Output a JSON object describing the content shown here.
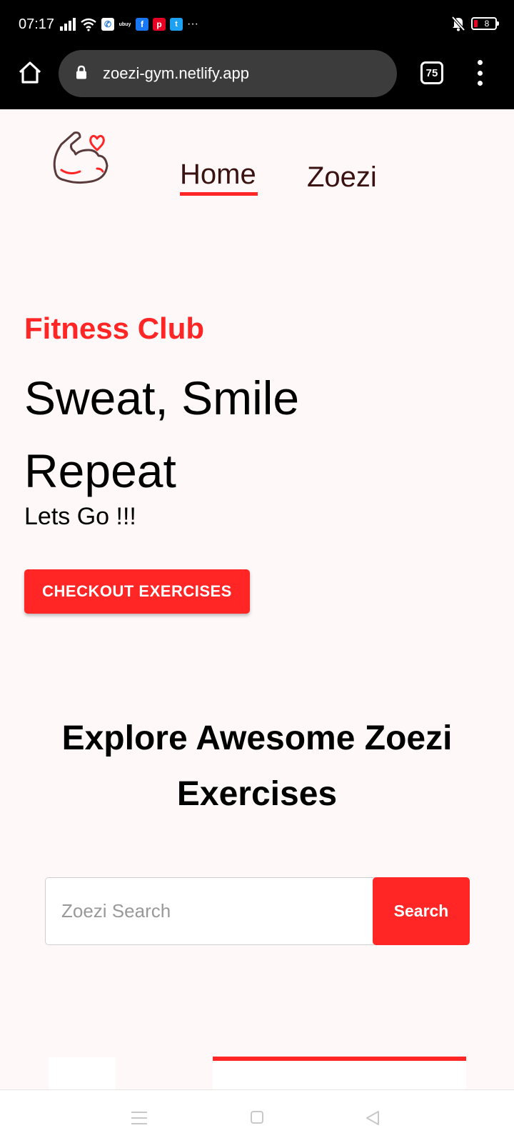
{
  "status_bar": {
    "time": "07:17",
    "battery": "8",
    "colors": {
      "background": "#000000",
      "battery_low": "#ee0022"
    },
    "icons": [
      "signal-icon",
      "wifi-icon",
      "phone-app-icon",
      "ubuy-app-icon",
      "facebook-app-icon",
      "pinterest-app-icon",
      "twitter-app-icon",
      "more-notifications-icon",
      "mute-icon",
      "battery-icon"
    ]
  },
  "browser": {
    "url": "zoezi-gym.netlify.app",
    "tab_count": "75",
    "icons": [
      "home-icon",
      "lock-icon",
      "tabs-icon",
      "overflow-menu-icon"
    ]
  },
  "nav": {
    "home": "Home",
    "zoezi": "Zoezi",
    "logo_icon": "flexed-arm-heart-icon"
  },
  "hero": {
    "subtitle": "Fitness Club",
    "title": "Sweat, Smile Repeat",
    "tagline": "Lets Go !!!",
    "button": "CHECKOUT EXERCISES"
  },
  "explore": {
    "title": "Explore Awesome Zoezi Exercises"
  },
  "search": {
    "placeholder": "Zoezi Search",
    "button": "Search"
  },
  "colors": {
    "accent": "#ff2625",
    "page_background": "#fff8f9",
    "nav_text": "#3a1212"
  },
  "system_nav": {
    "icons": [
      "recent-apps-icon",
      "home-square-icon",
      "back-triangle-icon"
    ]
  }
}
